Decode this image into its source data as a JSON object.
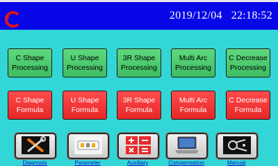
{
  "header": {
    "date": "2019/12/04",
    "time": "22:18:52"
  },
  "buttons_row1": [
    {
      "line1": "C Shape",
      "line2": "Processing"
    },
    {
      "line1": "U Shape",
      "line2": "Processing"
    },
    {
      "line1": "3R Shape",
      "line2": "Processing"
    },
    {
      "line1": "Multi Arc",
      "line2": "Processing"
    },
    {
      "line1": "C Decrease",
      "line2": "Processing"
    }
  ],
  "buttons_row2": [
    {
      "line1": "C Shape",
      "line2": "Formula"
    },
    {
      "line1": "U Shape",
      "line2": "Formula"
    },
    {
      "line1": "3R Shape",
      "line2": "Formula"
    },
    {
      "line1": "Multi Arc",
      "line2": "Formula"
    },
    {
      "line1": "C Decrease",
      "line2": "Formula"
    }
  ],
  "toolbar": [
    {
      "label": "Diagnosis",
      "icon": "tools-icon"
    },
    {
      "label": "Parameter",
      "icon": "parameter-icon"
    },
    {
      "label": "Auxiliary",
      "icon": "calculator-icon"
    },
    {
      "label": "Compensation",
      "icon": "laptop-icon"
    },
    {
      "label": "Manual",
      "icon": "manual-icon"
    }
  ],
  "colors": {
    "background": "#33d6d6",
    "header": "#0707e8",
    "green": "#4cc96d",
    "red": "#f03232"
  }
}
